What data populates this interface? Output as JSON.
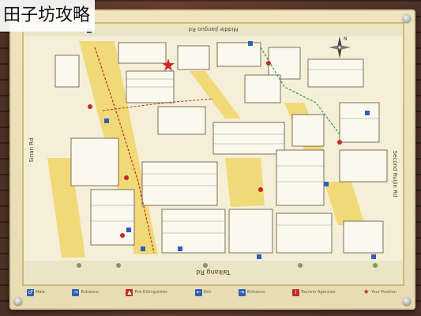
{
  "caption": "田子坊攻略",
  "map": {
    "street_top": "Middle Jianguo Rd",
    "street_bottom": "Taikang Rd",
    "street_left": "Sinan Rd",
    "street_right": "Second Ruijin Rd",
    "compass_label": "N",
    "colors": {
      "paper": "#f5efd7",
      "lane": "#f1d978",
      "route": "#c62828",
      "green_route": "#2e9b4e",
      "marker_blue": "#2f5fb8",
      "marker_red": "#c62828"
    }
  },
  "legend": [
    {
      "label": "Male",
      "icon": "male-toilet-icon",
      "color": "#2f5fb8"
    },
    {
      "label": "Entrance",
      "icon": "entrance-icon",
      "color": "#2f5fb8"
    },
    {
      "label": "Fire Extinguisher",
      "icon": "fire-extinguisher-icon",
      "color": "#c62828"
    },
    {
      "label": "Exit",
      "icon": "exit-icon",
      "color": "#2f5fb8"
    },
    {
      "label": "Entrance",
      "icon": "entrance-icon",
      "color": "#2f5fb8"
    },
    {
      "label": "Tourism Agencies",
      "icon": "tourism-agency-icon",
      "color": "#c62828"
    },
    {
      "label": "Your Position",
      "icon": "star-icon",
      "color": "#c62828"
    }
  ]
}
